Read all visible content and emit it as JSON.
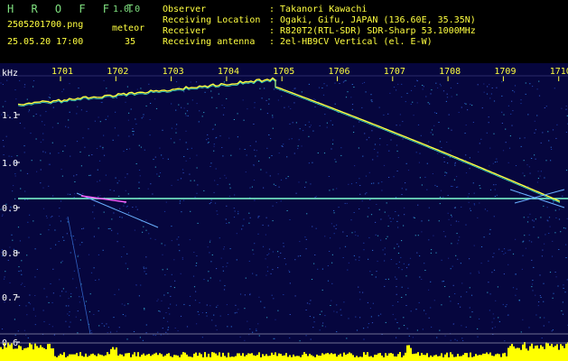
{
  "header": {
    "app_name": "H R O F F T",
    "app_version": "1.0.0",
    "file_name": "2505201700.png",
    "mode_label": "meteor",
    "datetime": "25.05.20 17:00",
    "count": "35",
    "info": [
      {
        "key": "Observer",
        "value": ": Takanori Kawachi"
      },
      {
        "key": "Receiving Location",
        "value": ": Ogaki, Gifu, JAPAN (136.60E, 35.35N)"
      },
      {
        "key": "Receiver",
        "value": ": R820T2(RTL-SDR) SDR-Sharp 53.1000MHz"
      },
      {
        "key": "Receiving antenna",
        "value": ": 2el-HB9CV Vertical (el. E-W)"
      }
    ]
  },
  "spectrogram": {
    "unit_label": "kHz",
    "time_ticks": [
      "1701",
      "1702",
      "1703",
      "1704",
      "1705",
      "1706",
      "1707",
      "1708",
      "1709",
      "1710"
    ],
    "freq_ticks": [
      "1.1",
      "1.0",
      "0.9",
      "0.8",
      "0.7",
      "0.6"
    ],
    "colors": {
      "background": "#0a0a4a",
      "signal": "#7fffd4",
      "trace": "#ffff40",
      "level": "#ffff00",
      "axis": "#ffffff",
      "ticks": "#ffff40"
    }
  }
}
